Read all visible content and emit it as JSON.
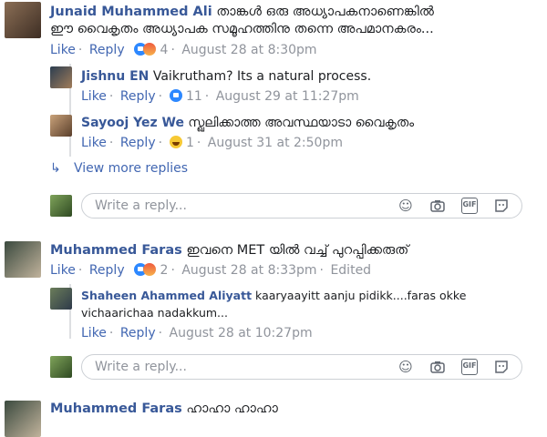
{
  "comments": [
    {
      "author": "Junaid Muhammed Ali",
      "text_line1": "താങ്കൾ ഒരു അധ്യാപകനാണെങ്കിൽ",
      "text_line2": "ഈ വൈകൃതം അധ്യാപക സമൂഹത്തിനു തന്നെ അപമാനകരം...",
      "like": "Like",
      "reply": "Reply",
      "reactions": "4",
      "time": "August 28 at 8:30pm",
      "replies": [
        {
          "author": "Jishnu EN",
          "text": "Vaikrutham? Its a natural process.",
          "like": "Like",
          "reply": "Reply",
          "reactions": "11",
          "time": "August 29 at 11:27pm"
        },
        {
          "author": "Sayooj Yez We",
          "text": "സ്ഖലിക്കാത്ത അവസ്ഥയാടാ വൈകൃതം",
          "like": "Like",
          "reply": "Reply",
          "reactions": "1",
          "time": "August 31 at 2:50pm"
        }
      ],
      "view_more": "View more replies"
    },
    {
      "author": "Muhammed Faras",
      "text": "ഇവനെ MET യിൽ വച്ച് പുറപ്പിക്കരുത്",
      "like": "Like",
      "reply": "Reply",
      "reactions": "2",
      "time": "August 28 at 8:33pm",
      "edited": "Edited",
      "replies": [
        {
          "author": "Shaheen Ahammed Aliyatt",
          "text_line1": "kaaryaayitt aanju pidikk....faras okke",
          "text_line2": "vichaarichaa nadakkum...",
          "like": "Like",
          "reply": "Reply",
          "time": "August 28 at 10:27pm"
        }
      ]
    },
    {
      "author": "Muhammed Faras",
      "text": "ഹാഹാ ഹാഹാ"
    }
  ],
  "reply_box": {
    "placeholder": "Write a reply..."
  },
  "icons": {
    "emoji": "smiley-icon",
    "camera": "camera-icon",
    "gif": "GIF",
    "sticker": "sticker-icon",
    "reply_arrow": "reply-arrow-icon"
  },
  "colors": {
    "link": "#385898",
    "action": "#4267b2",
    "meta": "#90949c"
  }
}
